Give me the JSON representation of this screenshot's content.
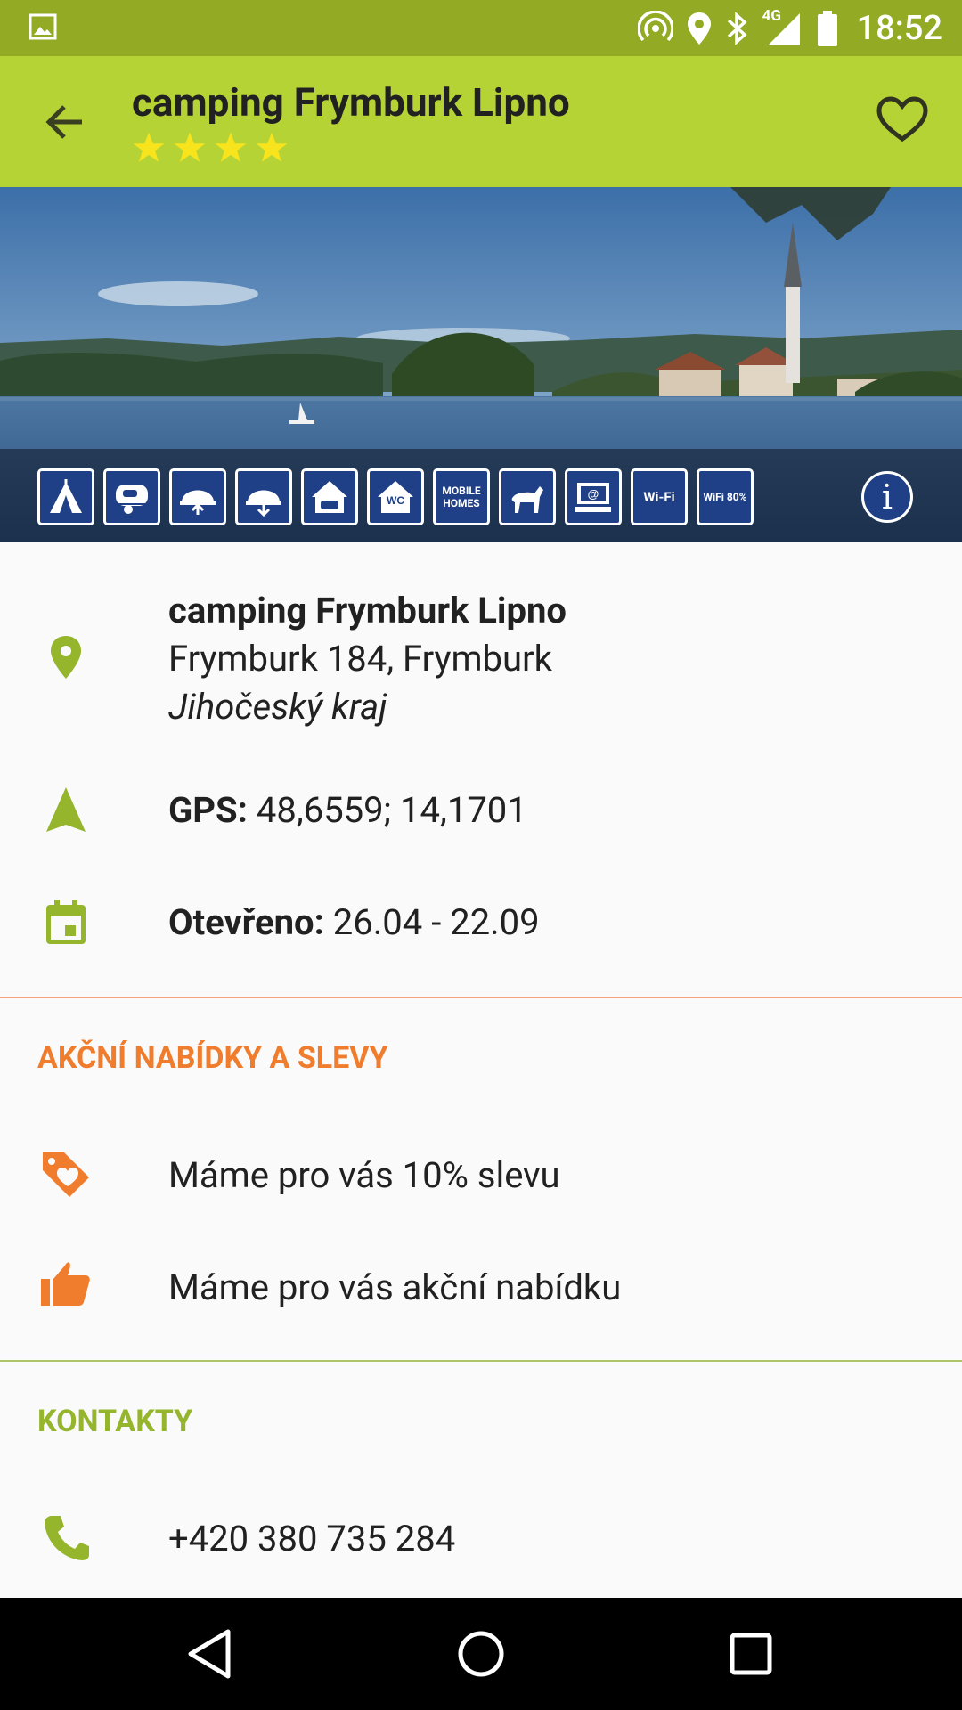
{
  "status_bar": {
    "time": "18:52",
    "network": "4G",
    "icons": [
      "image-icon",
      "hotspot-icon",
      "location-icon",
      "bluetooth-icon",
      "signal-icon",
      "battery-icon"
    ]
  },
  "header": {
    "title": "camping Frymburk Lipno",
    "rating_stars": 4,
    "back_icon": "arrow-back-icon",
    "favorite_icon": "heart-outline-icon"
  },
  "amenities": [
    {
      "name": "tent",
      "label": ""
    },
    {
      "name": "caravan",
      "label": ""
    },
    {
      "name": "caravan-entry",
      "label": ""
    },
    {
      "name": "caravan-exit",
      "label": ""
    },
    {
      "name": "cabin",
      "label": ""
    },
    {
      "name": "wc",
      "label": "WC"
    },
    {
      "name": "mobile-homes",
      "label": "MOBILE HOMES"
    },
    {
      "name": "horse",
      "label": ""
    },
    {
      "name": "internet",
      "label": "@"
    },
    {
      "name": "wifi",
      "label": "Wi-Fi"
    },
    {
      "name": "wifi-80",
      "label": "WiFi 80%"
    }
  ],
  "details": {
    "name": "camping Frymburk Lipno",
    "address": "Frymburk 184, Frymburk",
    "region": "Jihočeský kraj",
    "gps_label": "GPS:",
    "gps_value": " 48,6559; 14,1701",
    "open_label": "Otevřeno:",
    "open_value": " 26.04 - 22.09"
  },
  "offers": {
    "heading": "AKČNÍ NABÍDKY A SLEVY",
    "discount": "Máme pro vás 10% slevu",
    "special": "Máme pro vás akční nabídku"
  },
  "contacts": {
    "heading": "KONTAKTY",
    "phone": "+420 380 735 284"
  },
  "colors": {
    "status_bar": "#93aa24",
    "app_bar": "#b6d336",
    "accent_green": "#94b52c",
    "accent_orange": "#f07d2e",
    "star": "#f7e41c",
    "amenity_blue": "#1f3f86"
  }
}
